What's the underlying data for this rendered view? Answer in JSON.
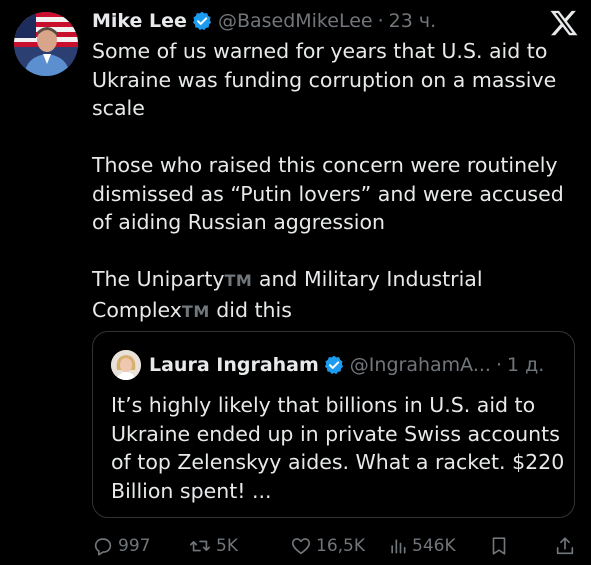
{
  "author": {
    "name": "Mike Lee",
    "handle": "@BasedMikeLee",
    "time": "23 ч."
  },
  "tweet": {
    "paragraphs": [
      "Some of us warned for years that U.S. aid to Ukraine was funding corruption on a massive scale",
      "Those who raised this concern were routinely dismissed as “Putin lovers” and were accused of aiding Russian aggression"
    ],
    "p3_part1": "The Uniparty",
    "tm": "TM",
    "p3_part2": " and Military Industrial",
    "p3_part3": "Complex",
    "p3_part4": " did this"
  },
  "quote": {
    "name": "Laura Ingraham",
    "handle": "@IngrahamA...",
    "time": "1 д.",
    "text": "It’s highly likely that billions in U.S. aid to Ukraine ended up in private Swiss accounts of top Zelenskyy aides. What a racket. $220 Billion spent! ..."
  },
  "actions": {
    "replies": "997",
    "reposts": "5K",
    "likes": "16,5K",
    "views": "546K"
  },
  "colors": {
    "background": "#000000",
    "text": "#e7e9ea",
    "muted": "#71767b",
    "verified": "#1d9bf0",
    "border": "#2f3336"
  }
}
